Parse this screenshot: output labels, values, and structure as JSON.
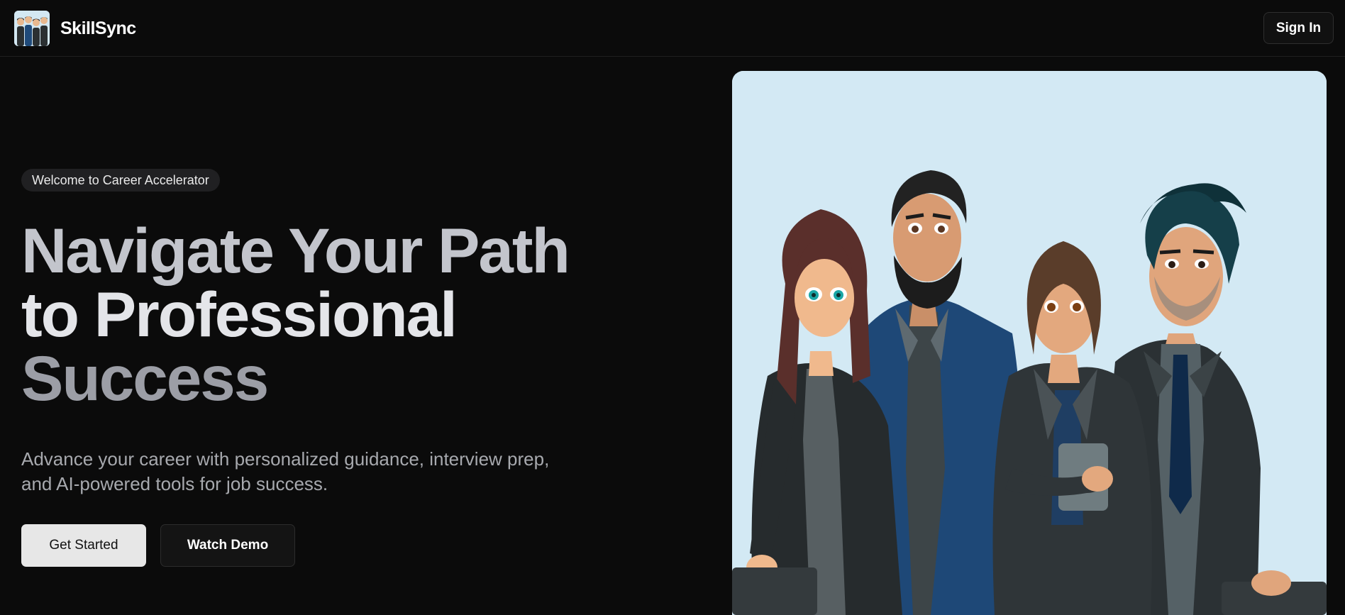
{
  "header": {
    "brand_name": "SkillSync",
    "signin_label": "Sign In"
  },
  "hero": {
    "badge": "Welcome to Career Accelerator",
    "headline_line1": "Navigate Your Path",
    "headline_line2": "to Professional",
    "headline_line3": "Success",
    "subtitle": "Advance your career with personalized guidance, interview prep, and AI-powered tools for job success.",
    "primary_cta": "Get Started",
    "secondary_cta": "Watch Demo"
  },
  "colors": {
    "background": "#0b0b0b",
    "illustration_bg": "#d3e9f4",
    "primary_button": "#e7e7e7",
    "suit_dark": "#2b3032",
    "suit_blue": "#1f4a7a"
  },
  "icons": {
    "logo": "team-illustration-thumbnail",
    "hero": "business-team-illustration"
  }
}
